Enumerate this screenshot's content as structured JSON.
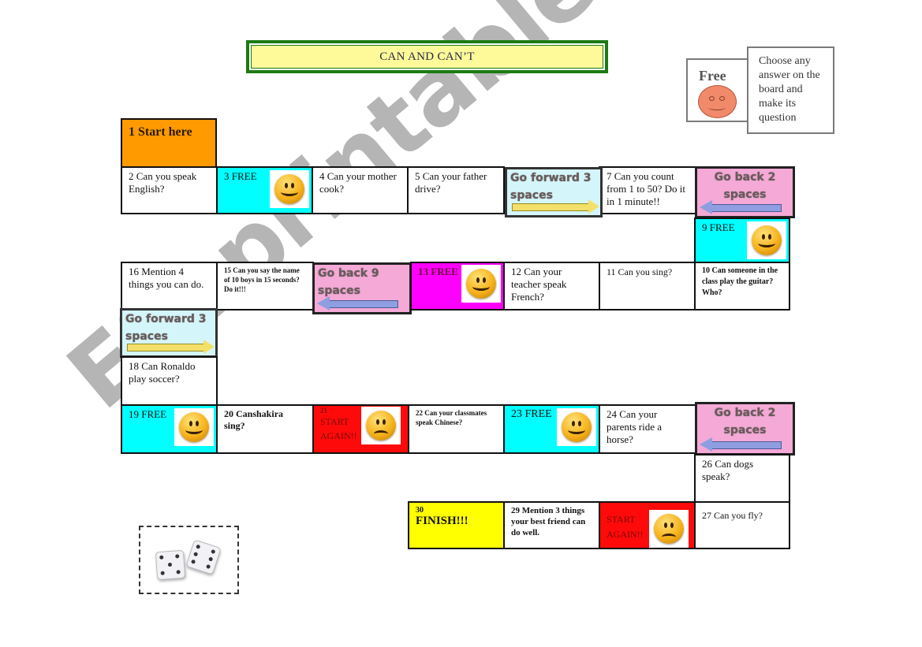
{
  "title": "CAN AND CAN’T",
  "legend": {
    "free_label": "Free",
    "free_icon": "smiley-face-icon",
    "instruction": "Choose any answer on the board and make its question"
  },
  "colors": {
    "title_border": "#1b7a12",
    "title_fill": "#fefa9a",
    "start": "#ff9a00",
    "free": "#00ffff",
    "free_13": "#ff00ff",
    "start_again": "#ff0a0a",
    "finish": "#ffff00",
    "go_forward": "#d4f6fa",
    "go_back": "#f4a9d6"
  },
  "cells": {
    "c1": "1 Start here",
    "c2": "2 Can you speak English?",
    "c3": "3 FREE",
    "c4": "4 Can your mother cook?",
    "c5": "5  Can your father drive?",
    "c6": "Go forward 3 spaces",
    "c7": "7 Can you count from 1 to 50? Do it in 1 minute!!",
    "c8": "Go back 2 spaces",
    "c9": "9 FREE",
    "c10": "10 Can someone in the class play the guitar? Who?",
    "c11": "11  Can you sing?",
    "c12": "12  Can your teacher speak French?",
    "c13": "13 FREE",
    "c14": "Go back 9 spaces",
    "c15": "15 Can you say the name of 10 boys in 15 seconds? Do it!!!",
    "c16": "16 Mention 4 things you can do.",
    "c17": "Go forward 3 spaces",
    "c18": "18 Can Ronaldo play soccer?",
    "c19": "19 FREE",
    "c20": "20 Canshakira sing?",
    "c21_num": "21",
    "c21": "START AGAIN!!",
    "c22": "22 Can your classmates speak Chinese?",
    "c23": "23 FREE",
    "c24": "24  Can your parents ride a horse?",
    "c25": "Go back 2 spaces",
    "c26": "26 Can dogs speak?",
    "c27": "27 Can you fly?",
    "c28": "START AGAIN!!",
    "c29": "29 Mention 3 things your best friend can do well.",
    "c30_num": "30",
    "c30": "FINISH!!!"
  },
  "dice_icon": "dice-icon",
  "watermark": "ESLprintables.com"
}
